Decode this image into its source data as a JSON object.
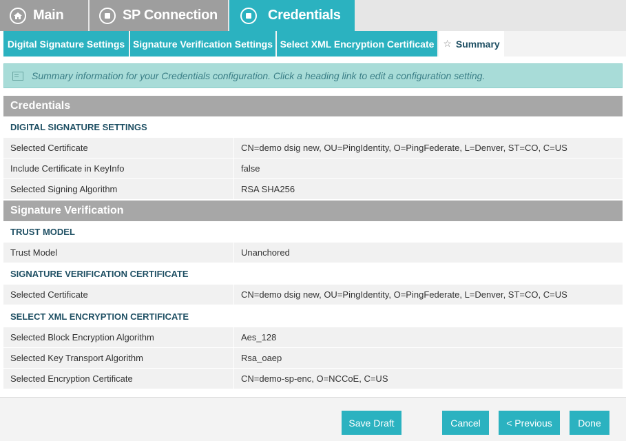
{
  "top_tabs": [
    {
      "label": "Main",
      "icon": "home-icon"
    },
    {
      "label": "SP Connection",
      "icon": "stop-icon"
    },
    {
      "label": "Credentials",
      "icon": "stop-icon"
    }
  ],
  "sub_tabs": [
    {
      "label": "Digital Signature Settings"
    },
    {
      "label": "Signature Verification Settings"
    },
    {
      "label": "Select XML Encryption Certificate"
    },
    {
      "label": "Summary",
      "icon": "star-icon"
    }
  ],
  "info": {
    "text": "Summary information for your Credentials configuration. Click a heading link to edit a configuration setting.",
    "icon": "info-panel-icon"
  },
  "sections": {
    "credentials": {
      "title": "Credentials",
      "digital_signature": {
        "heading": "DIGITAL SIGNATURE SETTINGS",
        "rows": [
          {
            "key": "Selected Certificate",
            "value": "CN=demo dsig new, OU=PingIdentity, O=PingFederate, L=Denver, ST=CO, C=US"
          },
          {
            "key": "Include Certificate in KeyInfo",
            "value": "false"
          },
          {
            "key": "Selected Signing Algorithm",
            "value": "RSA SHA256"
          }
        ]
      }
    },
    "signature_verification": {
      "title": "Signature Verification",
      "trust_model": {
        "heading": "TRUST MODEL",
        "rows": [
          {
            "key": "Trust Model",
            "value": "Unanchored"
          }
        ]
      },
      "verification_certificate": {
        "heading": "SIGNATURE VERIFICATION CERTIFICATE",
        "rows": [
          {
            "key": "Selected Certificate",
            "value": "CN=demo dsig new, OU=PingIdentity, O=PingFederate, L=Denver, ST=CO, C=US"
          }
        ]
      },
      "xml_encryption": {
        "heading": "SELECT XML ENCRYPTION CERTIFICATE",
        "rows": [
          {
            "key": "Selected Block Encryption Algorithm",
            "value": "Aes_128"
          },
          {
            "key": "Selected Key Transport Algorithm",
            "value": "Rsa_oaep"
          },
          {
            "key": "Selected Encryption Certificate",
            "value": "CN=demo-sp-enc, O=NCCoE, C=US"
          }
        ]
      }
    }
  },
  "footer": {
    "save_draft": "Save Draft",
    "cancel": "Cancel",
    "previous": "< Previous",
    "done": "Done"
  },
  "colors": {
    "accent": "#2bb2c0",
    "inactive_tab": "#9e9e9e",
    "section_header": "#a7a7a7",
    "heading_text": "#1e4f63",
    "info_bg": "#a8dcd8"
  }
}
